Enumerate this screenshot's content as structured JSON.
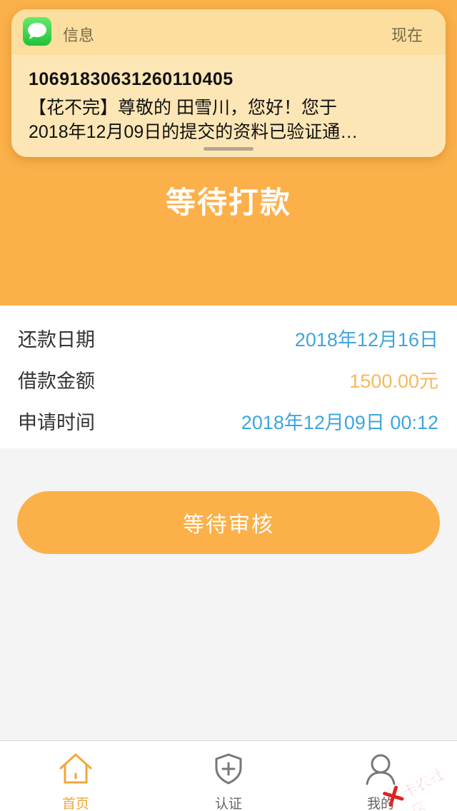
{
  "notification": {
    "app_name": "信息",
    "time": "现在",
    "sender": "10691830631260110405",
    "line1": "【花不完】尊敬的 田雪川，您好！您于",
    "line2": "2018年12月09日的提交的资料已验证通…",
    "icon": "messages-icon"
  },
  "header": {
    "title": "等待打款",
    "background_color": "#fcb049"
  },
  "info": {
    "rows": [
      {
        "label": "还款日期",
        "value": "2018年12月16日",
        "color": "#3ea6dc"
      },
      {
        "label": "借款金额",
        "value": "1500.00元",
        "color": "#f6b95d"
      },
      {
        "label": "申请时间",
        "value": "2018年12月09日 00:12",
        "color": "#3ea6dc"
      }
    ]
  },
  "action": {
    "button_label": "等待审核"
  },
  "tabbar": {
    "items": [
      {
        "label": "首页",
        "icon": "home-icon",
        "active": true,
        "color": "#f0a73c"
      },
      {
        "label": "认证",
        "icon": "shield-plus-icon",
        "active": false,
        "color": "#666666"
      },
      {
        "label": "我的",
        "icon": "user-icon",
        "active": false,
        "color": "#666666"
      }
    ]
  },
  "watermark": {
    "text": "卡农社区",
    "color": "#e02424"
  }
}
